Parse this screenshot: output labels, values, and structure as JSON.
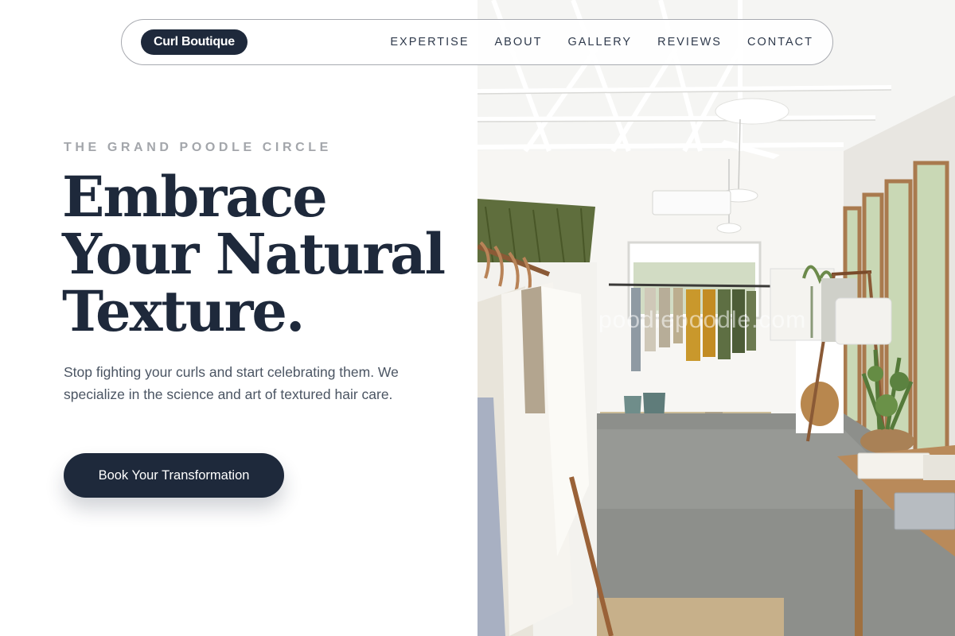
{
  "nav": {
    "brand": "Curl Boutique",
    "links": [
      {
        "label": "EXPERTISE"
      },
      {
        "label": "ABOUT"
      },
      {
        "label": "GALLERY"
      },
      {
        "label": "REVIEWS"
      },
      {
        "label": "CONTACT"
      }
    ]
  },
  "hero": {
    "eyebrow": "THE GRAND POODLE CIRCLE",
    "headline": [
      "Embrace",
      "Your Natural",
      "Texture."
    ],
    "body": "Stop fighting your curls and start celebrating them. We specialize in the science and art of textured hair care.",
    "cta_label": "Book Your Transformation",
    "image": {
      "subject": "bright boutique interior with clothing racks, hanging greenery, concrete floor and wooden tables",
      "watermark": "poodlepoodle.com"
    }
  },
  "colors": {
    "navy": "#1e293b",
    "eyebrow_gray": "#a3a6ab",
    "body_gray": "#4b5563",
    "background": "#ffffff"
  }
}
